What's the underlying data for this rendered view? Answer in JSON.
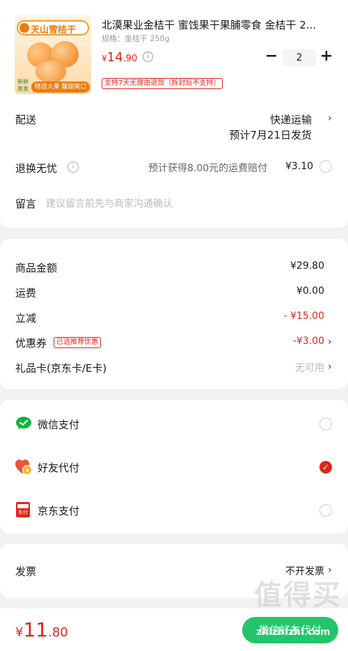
{
  "product": {
    "title": "北漠果业金桔干 蜜饯果干果脯零食 金桔干 2...",
    "spec": "规格：金桔干 250g",
    "price_symbol": "¥",
    "price_int": "14",
    "price_dec": ".90",
    "qty": "2",
    "return_tag": "支持7天无理由退货（拆封后不支持）",
    "image_brand": "天山雪桔干",
    "image_badge_top": "新鲜",
    "image_badge_bottom": "直发",
    "image_banner": "精选大果 酸甜爽口"
  },
  "delivery": {
    "label": "配送",
    "method": "快递运输",
    "eta": "预计7月21日发货"
  },
  "return_worry": {
    "label": "退换无忧",
    "desc": "预计获得8.00元的运费赔付",
    "price": "¥3.10"
  },
  "message": {
    "label": "留言",
    "placeholder": "建议留言前先与商家沟通确认"
  },
  "summary": {
    "goods_label": "商品金额",
    "goods_value": "¥29.80",
    "shipping_label": "运费",
    "shipping_value": "¥0.00",
    "discount_label": "立减",
    "discount_value": "- ¥15.00",
    "coupon_label": "优惠券",
    "coupon_tag": "已选推荐优惠",
    "coupon_value": "-¥3.00",
    "giftcard_label": "礼品卡(京东卡/E卡)",
    "giftcard_value": "无可用"
  },
  "payment": {
    "wechat": "微信支付",
    "friend": "好友代付",
    "jd": "京东支付",
    "jd_icon_text": "东付",
    "friend_icon_text": "¥"
  },
  "invoice": {
    "label": "发票",
    "value": "不开发票"
  },
  "footer": {
    "symbol": "¥",
    "total_int": "11",
    "total_dec": ".80",
    "button": "微信好友代付",
    "watermark_big": "值得买",
    "watermark_small": "zhizhizhi.com"
  },
  "colors": {
    "accent": "#e2231a",
    "wechat": "#09b83e",
    "button_green": "#23c46b"
  }
}
